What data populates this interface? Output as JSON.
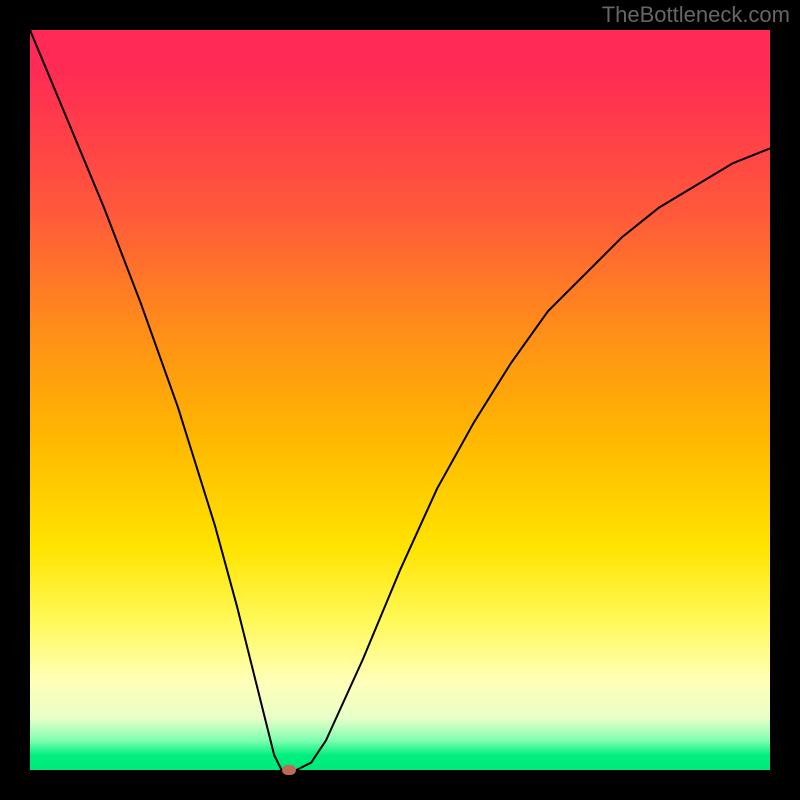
{
  "watermark": "TheBottleneck.com",
  "chart_data": {
    "type": "line",
    "title": "",
    "xlabel": "",
    "ylabel": "",
    "xlim": [
      0,
      100
    ],
    "ylim": [
      0,
      100
    ],
    "series": [
      {
        "name": "bottleneck-curve",
        "x": [
          0,
          5,
          10,
          15,
          20,
          25,
          28,
          30,
          32,
          33,
          34,
          35,
          36,
          38,
          40,
          45,
          50,
          55,
          60,
          65,
          70,
          75,
          80,
          85,
          90,
          95,
          100
        ],
        "y": [
          100,
          88,
          76,
          63,
          49,
          33,
          22,
          14,
          6,
          2,
          0,
          0,
          0,
          1,
          4,
          15,
          27,
          38,
          47,
          55,
          62,
          67,
          72,
          76,
          79,
          82,
          84
        ]
      }
    ],
    "marker": {
      "x": 35,
      "y": 0
    },
    "gradient_bands": [
      {
        "color": "#ff2a55",
        "stop": 0.0
      },
      {
        "color": "#ff5a3a",
        "stop": 0.25
      },
      {
        "color": "#ff8c1a",
        "stop": 0.4
      },
      {
        "color": "#ffb700",
        "stop": 0.55
      },
      {
        "color": "#ffe400",
        "stop": 0.7
      },
      {
        "color": "#fff95a",
        "stop": 0.8
      },
      {
        "color": "#ffffb8",
        "stop": 0.88
      },
      {
        "color": "#e8ffc8",
        "stop": 0.93
      },
      {
        "color": "#7fffb0",
        "stop": 0.96
      },
      {
        "color": "#00ef7f",
        "stop": 0.98
      },
      {
        "color": "#00e97a",
        "stop": 1.0
      }
    ]
  }
}
